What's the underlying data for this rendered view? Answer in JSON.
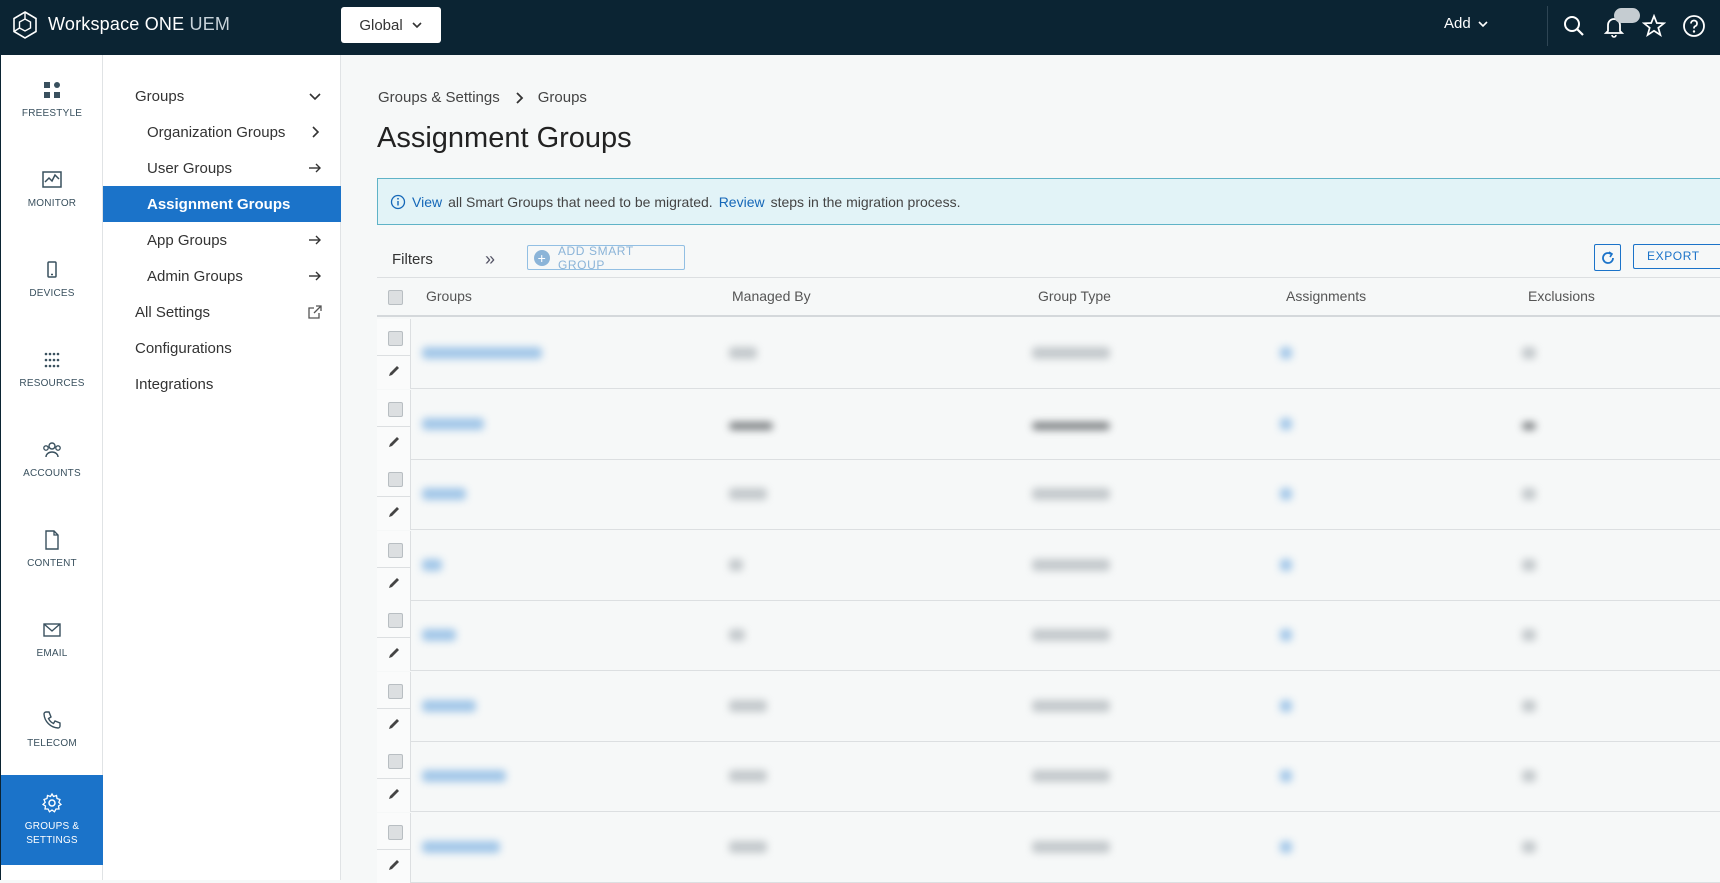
{
  "header": {
    "brand_main": "Workspace ONE",
    "brand_suffix": "UEM",
    "global_label": "Global",
    "add_label": "Add"
  },
  "rail": {
    "items": [
      {
        "label": "FREESTYLE",
        "icon": "freestyle-icon"
      },
      {
        "label": "MONITOR",
        "icon": "monitor-icon"
      },
      {
        "label": "DEVICES",
        "icon": "devices-icon"
      },
      {
        "label": "RESOURCES",
        "icon": "resources-icon"
      },
      {
        "label": "ACCOUNTS",
        "icon": "accounts-icon"
      },
      {
        "label": "CONTENT",
        "icon": "content-icon"
      },
      {
        "label": "EMAIL",
        "icon": "email-icon"
      },
      {
        "label": "TELECOM",
        "icon": "telecom-icon"
      },
      {
        "label_line1": "GROUPS &",
        "label_line2": "SETTINGS",
        "icon": "gear-icon",
        "active": true
      }
    ]
  },
  "subnav": {
    "items": [
      {
        "label": "Groups",
        "icon": "chevron-down-icon"
      },
      {
        "label": "Organization Groups",
        "icon": "chevron-right-icon"
      },
      {
        "label": "User Groups",
        "icon": "arrow-right-icon"
      },
      {
        "label": "Assignment Groups",
        "active": true
      },
      {
        "label": "App Groups",
        "icon": "arrow-right-icon"
      },
      {
        "label": "Admin Groups",
        "icon": "arrow-right-icon"
      },
      {
        "label": "All Settings",
        "icon": "external-link-icon"
      },
      {
        "label": "Configurations"
      },
      {
        "label": "Integrations"
      }
    ]
  },
  "main": {
    "breadcrumb": [
      "Groups & Settings",
      "Groups"
    ],
    "title": "Assignment Groups",
    "banner": {
      "link1": "View",
      "text1": "all Smart Groups that need to be migrated.",
      "link2": "Review",
      "text2": "steps in the migration process."
    },
    "toolbar": {
      "filters_label": "Filters",
      "add_smart_group_label": "ADD SMART GROUP",
      "export_label": "EXPORT"
    },
    "table": {
      "columns": [
        "Groups",
        "Managed By",
        "Group Type",
        "Assignments",
        "Exclusions"
      ],
      "row_count": 8
    }
  },
  "colors": {
    "header_bg": "#0b2433",
    "accent": "#1b73c9",
    "banner_bg": "#e2f3f7",
    "banner_border": "#5fb3c7"
  }
}
